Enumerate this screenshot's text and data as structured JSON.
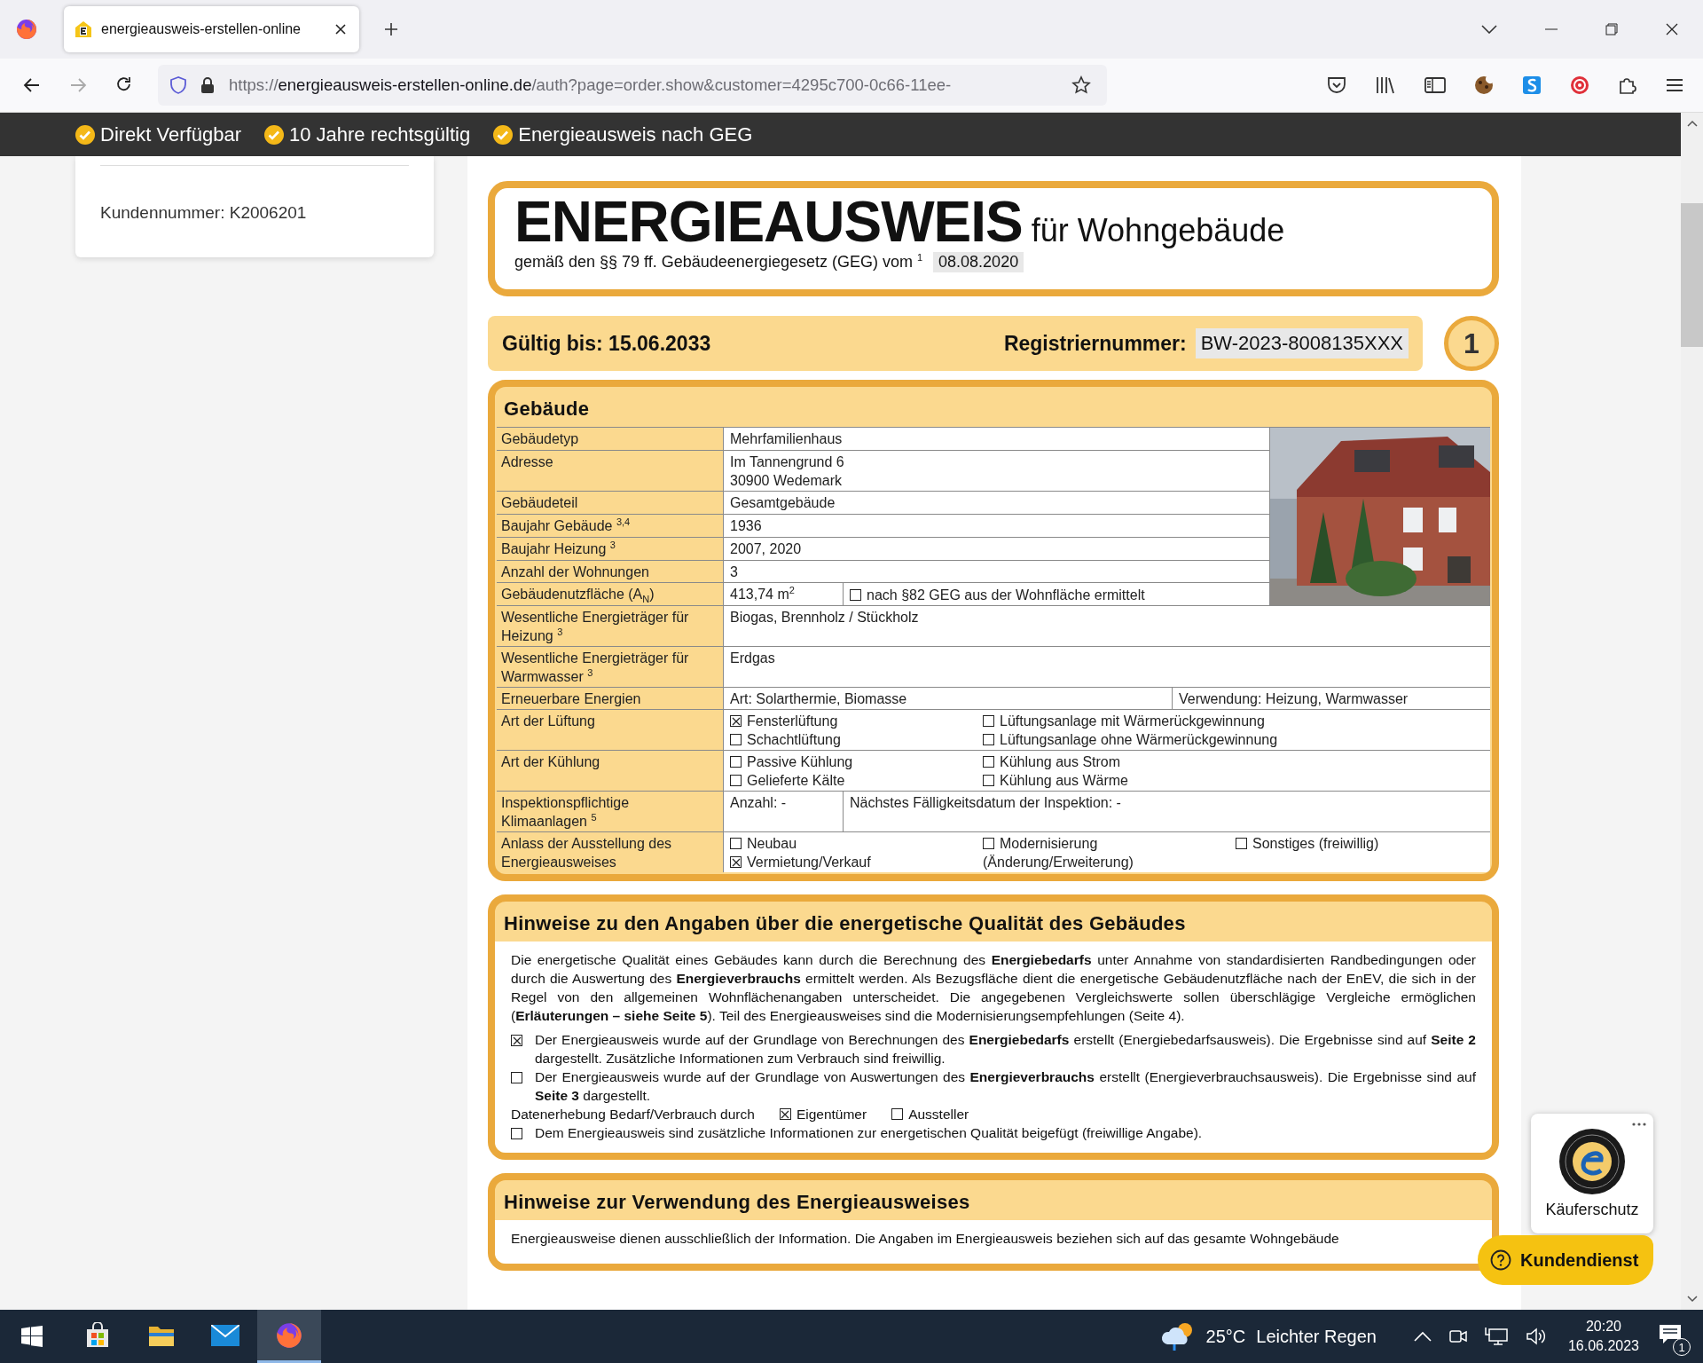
{
  "browser": {
    "tab_title": "energieausweis-erstellen-online",
    "url_scheme": "https://",
    "url_domain": "energieausweis-erstellen-online.de",
    "url_path": "/auth?page=order.show&customer=4295c700-0c66-11ee-"
  },
  "banner": [
    "Direkt Verfügbar",
    "10 Jahre rechtsgültig",
    "Energieausweis nach GEG"
  ],
  "customer_card": {
    "customer_number": "Kundennummer: K2006201"
  },
  "certificate": {
    "title": "ENERGIEAUSWEIS",
    "subtitle": "für Wohngebäude",
    "basis": "gemäß den §§ 79 ff. Gebäudeenergiegesetz (GEG) vom $^{1}$",
    "law_date": "08.08.2020",
    "valid_until": "Gültig bis: 15.06.2033",
    "registration_label": "Registriernummer:",
    "registration_number": "BW-2023-8008135XXX",
    "page_number": "1"
  },
  "gebaeude": {
    "title": "Gebäude",
    "top_rows": [
      {
        "label": "Gebäudetyp",
        "kind": "text",
        "value": "Mehrfamilienhaus"
      },
      {
        "label": "Adresse",
        "kind": "lines",
        "lines": [
          "Im Tannengrund 6",
          "30900 Wedemark"
        ]
      },
      {
        "label": "Gebäudeteil",
        "kind": "text",
        "value": "Gesamtgebäude"
      },
      {
        "label": "Baujahr Gebäude $^{3,4}$",
        "kind": "text",
        "value": "1936"
      },
      {
        "label": "Baujahr Heizung $^{3}$",
        "kind": "text",
        "value": "2007, 2020"
      },
      {
        "label": "Anzahl der Wohnungen",
        "kind": "text",
        "value": "3"
      },
      {
        "label": "Gebäudenutzfläche (A$_{N}$)",
        "kind": "area",
        "value": "413,74 m$^{2}$",
        "check": {
          "label": "nach §82 GEG aus der Wohnfläche ermittelt",
          "checked": false
        }
      }
    ],
    "rows": [
      {
        "label": "Wesentliche Energieträger für Heizung $^{3}$",
        "kind": "text",
        "value": "Biogas, Brennholz / Stückholz"
      },
      {
        "label": "Wesentliche Energieträger für Warmwasser $^{3}$",
        "kind": "text",
        "value": "Erdgas"
      },
      {
        "label": "Erneuerbare Energien",
        "kind": "split",
        "cells": [
          "Art: Solarthermie, Biomasse",
          "Verwendung: Heizung, Warmwasser"
        ]
      },
      {
        "label": "Art der Lüftung",
        "kind": "checks",
        "options": [
          {
            "label": "Fensterlüftung",
            "checked": true
          },
          {
            "label": "Lüftungsanlage mit Wärmerückgewinnung",
            "checked": false
          },
          {
            "label": "Schachtlüftung",
            "checked": false
          },
          {
            "label": "Lüftungsanlage ohne Wärmerückgewinnung",
            "checked": false
          }
        ]
      },
      {
        "label": "Art der Kühlung",
        "kind": "checks",
        "options": [
          {
            "label": "Passive Kühlung",
            "checked": false
          },
          {
            "label": "Kühlung aus Strom",
            "checked": false
          },
          {
            "label": "Gelieferte Kälte",
            "checked": false
          },
          {
            "label": "Kühlung aus Wärme",
            "checked": false
          }
        ]
      },
      {
        "label": "Inspektionspflichtige Klimaanlagen $^{5}$",
        "kind": "pair",
        "cells": [
          "Anzahl: -",
          "Nächstes Fälligkeitsdatum der Inspektion: -"
        ]
      },
      {
        "label": "Anlass der Ausstellung des Energieausweises",
        "kind": "reasons",
        "options": [
          {
            "label": "Neubau",
            "checked": false
          },
          {
            "label": "Modernisierung",
            "note": "(Änderung/Erweiterung)",
            "checked": false
          },
          {
            "label": "Sonstiges (freiwillig)",
            "checked": false
          },
          {
            "label": "Vermietung/Verkauf",
            "checked": true
          }
        ]
      }
    ]
  },
  "hinweise": {
    "title": "Hinweise zu den Angaben über die energetische Qualität des Gebäudes",
    "paragraph": "Die energetische Qualität eines Gebäudes kann durch die Berechnung des **Energiebedarfs** unter Annahme von standardisierten Randbedingungen oder durch die Auswertung des **Energieverbrauchs** ermittelt werden. Als Bezugsfläche dient die energetische Gebäudenutzfläche nach der EnEV, die sich in der Regel von den allgemeinen Wohnflächenangaben unterscheidet. Die angegebenen Vergleichswerte sollen überschlägige Vergleiche ermöglichen (**Erläuterungen – siehe Seite 5**). Teil des Energieausweises sind die Modernisierungsempfehlungen (Seite 4).",
    "items": [
      {
        "kind": "check",
        "checked": true,
        "text": "Der Energieausweis wurde auf der Grundlage von Berechnungen des **Energiebedarfs** erstellt (Energiebedarfsausweis). Die Ergebnisse sind auf **Seite 2** dargestellt. Zusätzliche Informationen zum Verbrauch sind freiwillig."
      },
      {
        "kind": "check",
        "checked": false,
        "text": "Der Energieausweis wurde auf der Grundlage von Auswertungen des **Energieverbrauchs** erstellt (Energieverbrauchsausweis). Die Ergebnisse sind auf **Seite 3** dargestellt."
      },
      {
        "kind": "choice",
        "text": "Datenerhebung Bedarf/Verbrauch durch",
        "options": [
          {
            "label": "Eigentümer",
            "checked": true
          },
          {
            "label": "Aussteller",
            "checked": false
          }
        ]
      },
      {
        "kind": "check",
        "checked": false,
        "text": "Dem Energieausweis sind zusätzliche Informationen zur energetischen Qualität beigefügt (freiwillige Angabe)."
      }
    ]
  },
  "verwendung": {
    "title": "Hinweise zur Verwendung des Energieausweises",
    "paragraph": "Energieausweise dienen ausschließlich der Information. Die Angaben im Energieausweis beziehen sich auf das gesamte Wohngebäude"
  },
  "trust_widget": {
    "label": "Käuferschutz"
  },
  "support_button": "Kundendienst",
  "taskbar": {
    "apps": [
      {
        "kind": "store",
        "selected": false
      },
      {
        "kind": "explorer",
        "selected": false
      },
      {
        "kind": "mail",
        "selected": false
      },
      {
        "kind": "firefox",
        "selected": true
      }
    ],
    "temperature": "25°C",
    "weather": "Leichter Regen",
    "time": "20:20",
    "date": "16.06.2023",
    "notifications": "1"
  }
}
